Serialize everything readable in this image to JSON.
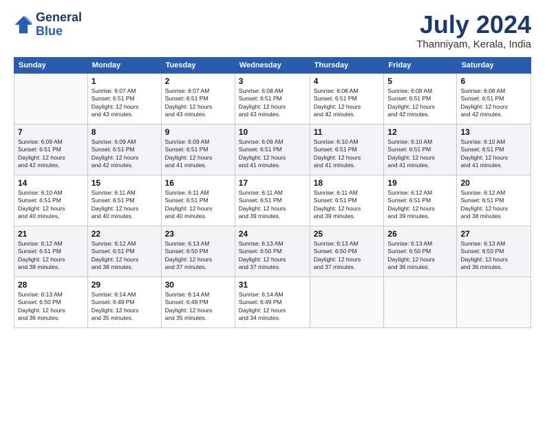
{
  "header": {
    "logo_line1": "General",
    "logo_line2": "Blue",
    "title": "July 2024",
    "subtitle": "Thanniyam, Kerala, India"
  },
  "calendar": {
    "days_of_week": [
      "Sunday",
      "Monday",
      "Tuesday",
      "Wednesday",
      "Thursday",
      "Friday",
      "Saturday"
    ],
    "weeks": [
      [
        {
          "day": "",
          "sunrise": "",
          "sunset": "",
          "daylight": ""
        },
        {
          "day": "1",
          "sunrise": "Sunrise: 6:07 AM",
          "sunset": "Sunset: 6:51 PM",
          "daylight": "Daylight: 12 hours and 43 minutes."
        },
        {
          "day": "2",
          "sunrise": "Sunrise: 6:07 AM",
          "sunset": "Sunset: 6:51 PM",
          "daylight": "Daylight: 12 hours and 43 minutes."
        },
        {
          "day": "3",
          "sunrise": "Sunrise: 6:08 AM",
          "sunset": "Sunset: 6:51 PM",
          "daylight": "Daylight: 12 hours and 43 minutes."
        },
        {
          "day": "4",
          "sunrise": "Sunrise: 6:08 AM",
          "sunset": "Sunset: 6:51 PM",
          "daylight": "Daylight: 12 hours and 42 minutes."
        },
        {
          "day": "5",
          "sunrise": "Sunrise: 6:08 AM",
          "sunset": "Sunset: 6:51 PM",
          "daylight": "Daylight: 12 hours and 42 minutes."
        },
        {
          "day": "6",
          "sunrise": "Sunrise: 6:08 AM",
          "sunset": "Sunset: 6:51 PM",
          "daylight": "Daylight: 12 hours and 42 minutes."
        }
      ],
      [
        {
          "day": "7",
          "sunrise": "Sunrise: 6:09 AM",
          "sunset": "Sunset: 6:51 PM",
          "daylight": "Daylight: 12 hours and 42 minutes."
        },
        {
          "day": "8",
          "sunrise": "Sunrise: 6:09 AM",
          "sunset": "Sunset: 6:51 PM",
          "daylight": "Daylight: 12 hours and 42 minutes."
        },
        {
          "day": "9",
          "sunrise": "Sunrise: 6:09 AM",
          "sunset": "Sunset: 6:51 PM",
          "daylight": "Daylight: 12 hours and 41 minutes."
        },
        {
          "day": "10",
          "sunrise": "Sunrise: 6:09 AM",
          "sunset": "Sunset: 6:51 PM",
          "daylight": "Daylight: 12 hours and 41 minutes."
        },
        {
          "day": "11",
          "sunrise": "Sunrise: 6:10 AM",
          "sunset": "Sunset: 6:51 PM",
          "daylight": "Daylight: 12 hours and 41 minutes."
        },
        {
          "day": "12",
          "sunrise": "Sunrise: 6:10 AM",
          "sunset": "Sunset: 6:51 PM",
          "daylight": "Daylight: 12 hours and 41 minutes."
        },
        {
          "day": "13",
          "sunrise": "Sunrise: 6:10 AM",
          "sunset": "Sunset: 6:51 PM",
          "daylight": "Daylight: 12 hours and 41 minutes."
        }
      ],
      [
        {
          "day": "14",
          "sunrise": "Sunrise: 6:10 AM",
          "sunset": "Sunset: 6:51 PM",
          "daylight": "Daylight: 12 hours and 40 minutes."
        },
        {
          "day": "15",
          "sunrise": "Sunrise: 6:11 AM",
          "sunset": "Sunset: 6:51 PM",
          "daylight": "Daylight: 12 hours and 40 minutes."
        },
        {
          "day": "16",
          "sunrise": "Sunrise: 6:11 AM",
          "sunset": "Sunset: 6:51 PM",
          "daylight": "Daylight: 12 hours and 40 minutes."
        },
        {
          "day": "17",
          "sunrise": "Sunrise: 6:11 AM",
          "sunset": "Sunset: 6:51 PM",
          "daylight": "Daylight: 12 hours and 39 minutes."
        },
        {
          "day": "18",
          "sunrise": "Sunrise: 6:11 AM",
          "sunset": "Sunset: 6:51 PM",
          "daylight": "Daylight: 12 hours and 39 minutes."
        },
        {
          "day": "19",
          "sunrise": "Sunrise: 6:12 AM",
          "sunset": "Sunset: 6:51 PM",
          "daylight": "Daylight: 12 hours and 39 minutes."
        },
        {
          "day": "20",
          "sunrise": "Sunrise: 6:12 AM",
          "sunset": "Sunset: 6:51 PM",
          "daylight": "Daylight: 12 hours and 38 minutes."
        }
      ],
      [
        {
          "day": "21",
          "sunrise": "Sunrise: 6:12 AM",
          "sunset": "Sunset: 6:51 PM",
          "daylight": "Daylight: 12 hours and 38 minutes."
        },
        {
          "day": "22",
          "sunrise": "Sunrise: 6:12 AM",
          "sunset": "Sunset: 6:51 PM",
          "daylight": "Daylight: 12 hours and 38 minutes."
        },
        {
          "day": "23",
          "sunrise": "Sunrise: 6:13 AM",
          "sunset": "Sunset: 6:50 PM",
          "daylight": "Daylight: 12 hours and 37 minutes."
        },
        {
          "day": "24",
          "sunrise": "Sunrise: 6:13 AM",
          "sunset": "Sunset: 6:50 PM",
          "daylight": "Daylight: 12 hours and 37 minutes."
        },
        {
          "day": "25",
          "sunrise": "Sunrise: 6:13 AM",
          "sunset": "Sunset: 6:50 PM",
          "daylight": "Daylight: 12 hours and 37 minutes."
        },
        {
          "day": "26",
          "sunrise": "Sunrise: 6:13 AM",
          "sunset": "Sunset: 6:50 PM",
          "daylight": "Daylight: 12 hours and 36 minutes."
        },
        {
          "day": "27",
          "sunrise": "Sunrise: 6:13 AM",
          "sunset": "Sunset: 6:50 PM",
          "daylight": "Daylight: 12 hours and 36 minutes."
        }
      ],
      [
        {
          "day": "28",
          "sunrise": "Sunrise: 6:13 AM",
          "sunset": "Sunset: 6:50 PM",
          "daylight": "Daylight: 12 hours and 36 minutes."
        },
        {
          "day": "29",
          "sunrise": "Sunrise: 6:14 AM",
          "sunset": "Sunset: 6:49 PM",
          "daylight": "Daylight: 12 hours and 35 minutes."
        },
        {
          "day": "30",
          "sunrise": "Sunrise: 6:14 AM",
          "sunset": "Sunset: 6:49 PM",
          "daylight": "Daylight: 12 hours and 35 minutes."
        },
        {
          "day": "31",
          "sunrise": "Sunrise: 6:14 AM",
          "sunset": "Sunset: 6:49 PM",
          "daylight": "Daylight: 12 hours and 34 minutes."
        },
        {
          "day": "",
          "sunrise": "",
          "sunset": "",
          "daylight": ""
        },
        {
          "day": "",
          "sunrise": "",
          "sunset": "",
          "daylight": ""
        },
        {
          "day": "",
          "sunrise": "",
          "sunset": "",
          "daylight": ""
        }
      ]
    ]
  }
}
